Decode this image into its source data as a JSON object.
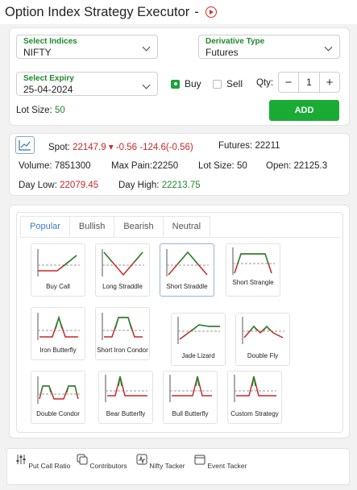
{
  "header": {
    "title": "Option Index Strategy Executor",
    "separator": "-"
  },
  "form": {
    "index": {
      "label": "Select Indices",
      "value": "NIFTY"
    },
    "derivative": {
      "label": "Derivative Type",
      "value": "Futures"
    },
    "expiry": {
      "label": "Select Expiry",
      "value": "25-04-2024"
    },
    "buy_label": "Buy",
    "sell_label": "Sell",
    "side_selected": "Buy",
    "qty_label": "Qty:",
    "qty_minus": "−",
    "qty_value": "1",
    "qty_plus": "+",
    "lot_label": "Lot Size:",
    "lot_value": "50",
    "add_label": "ADD"
  },
  "market": {
    "spot_label": "Spot:",
    "spot_value": "22147.9",
    "spot_change": "-0.56",
    "spot_change_full": "-124.6(-0.56)",
    "futures_label": "Futures:",
    "futures_value": "22211",
    "volume": "Volume: 7851300",
    "max_pain": "Max Pain:22250",
    "lot_size": "Lot Size: 50",
    "open_label": "Open:",
    "open_value": "22125.3",
    "day_low_label": "Day Low:",
    "day_low_value": "22079.45",
    "day_high_label": "Day High:",
    "day_high_value": "22213.75"
  },
  "tabs": [
    "Popular",
    "Bullish",
    "Bearish",
    "Neutral"
  ],
  "strategies": [
    "Buy Call",
    "Long Straddle",
    "Short Straddle",
    "Short Strangle",
    "Iron Butterfly",
    "Short Iron Condor",
    "Jade Lizard",
    "Double Fly",
    "Double Condor",
    "Bear Butterfly",
    "Bull Butterfly",
    "Custom Strategy"
  ],
  "footer": [
    "Put Call Ratio",
    "Contributors",
    "Nifty Tacker",
    "Event Tacker"
  ],
  "colors": {
    "accent_green": "#1aab35",
    "loss_red": "#c62828",
    "tab_active": "#3a7bc8"
  },
  "icons": [
    "play-circle-icon",
    "chevron-down-icon",
    "chart-line-icon",
    "sliders-icon",
    "layers-icon",
    "activity-icon",
    "calendar-icon"
  ]
}
